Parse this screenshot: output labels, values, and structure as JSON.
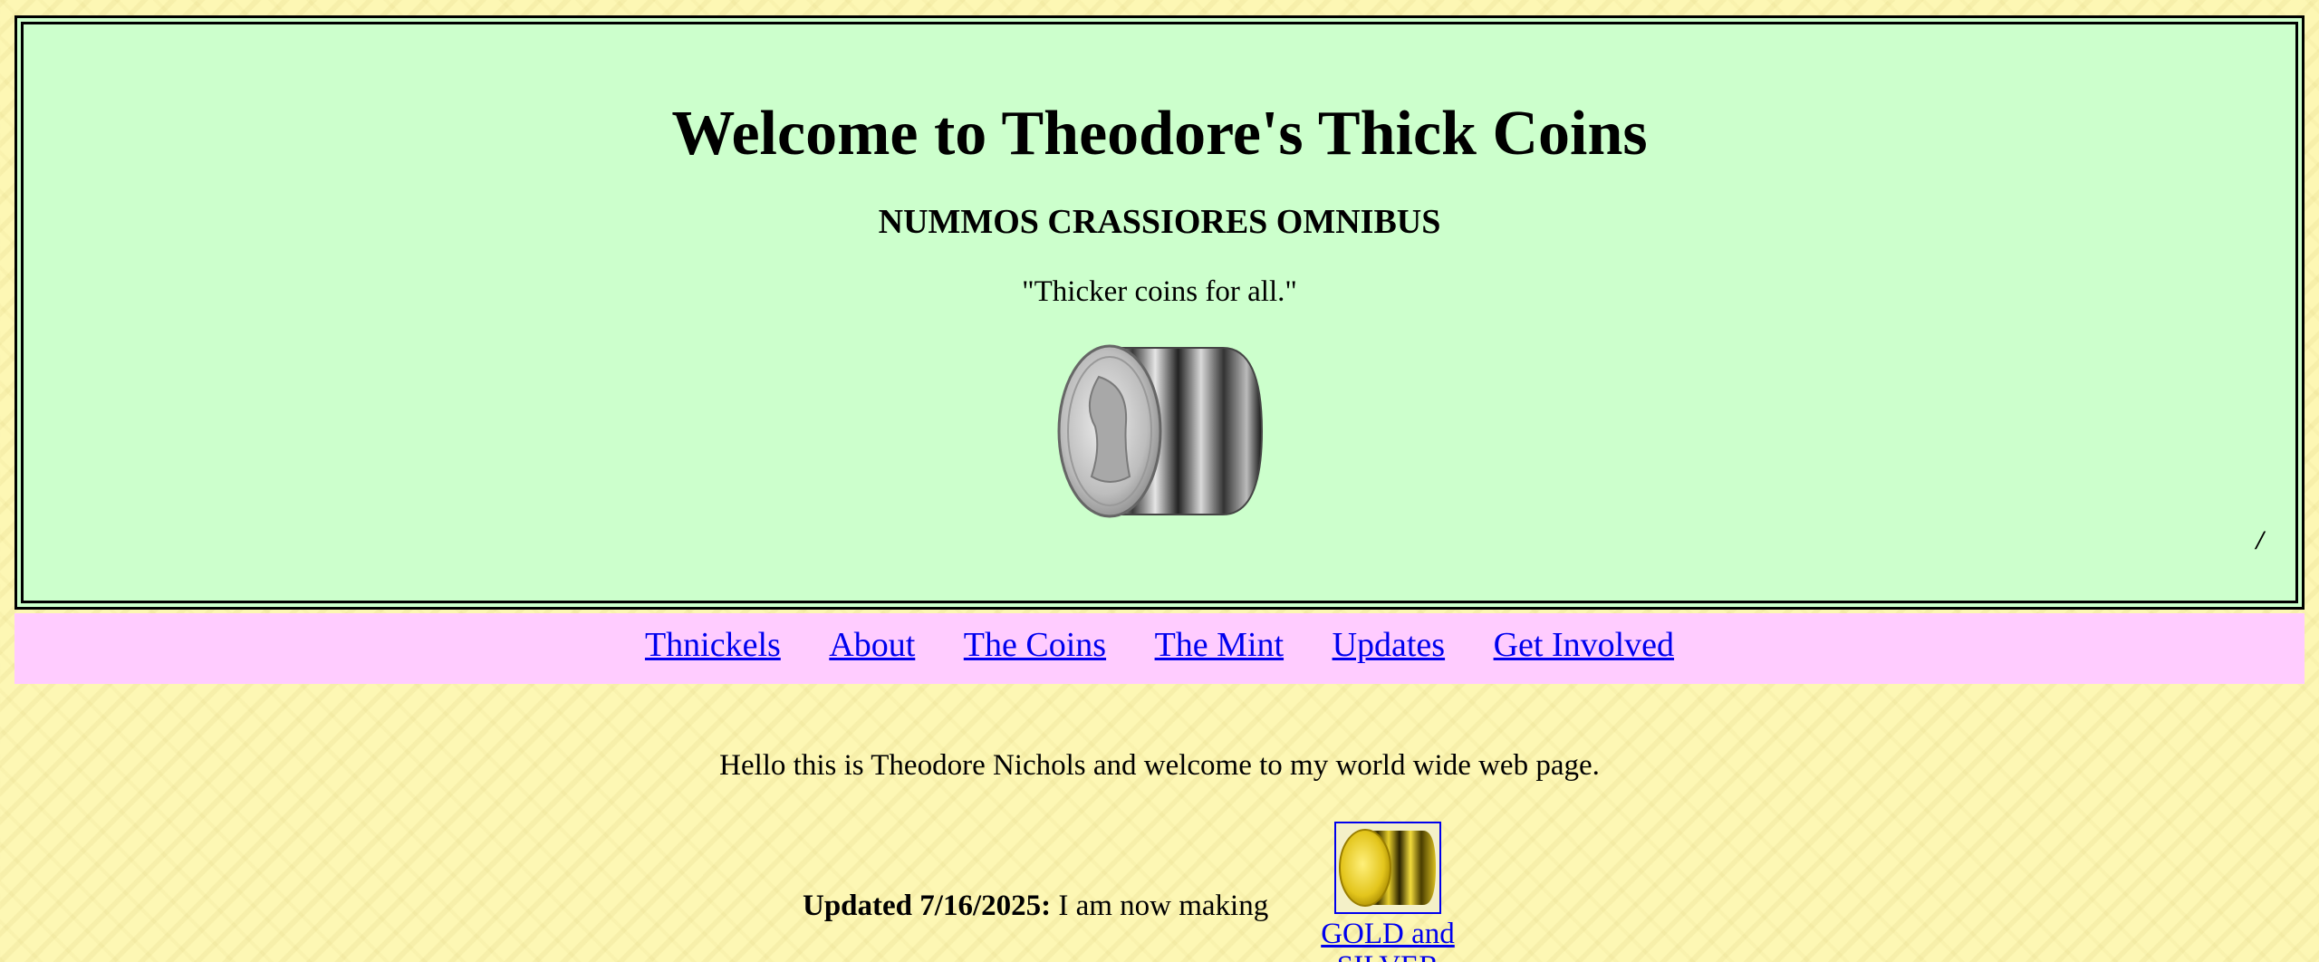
{
  "header": {
    "title": "Welcome to Theodore's Thick Coins",
    "motto": "NUMMOS CRASSIORES OMNIBUS",
    "motto_translation": "\"Thicker coins for all.\"",
    "coin_image": "thick-silver-coin",
    "corner_mark": "/"
  },
  "nav": {
    "items": [
      {
        "label": "Thnickels"
      },
      {
        "label": "About"
      },
      {
        "label": "The Coins"
      },
      {
        "label": "The Mint"
      },
      {
        "label": "Updates"
      },
      {
        "label": "Get Involved"
      }
    ]
  },
  "main": {
    "intro": "Hello this is Theodore Nichols and welcome to my world wide web page.",
    "update": {
      "date_label": "Updated 7/16/2025:",
      "text": " I am now making",
      "link_label": "GOLD and SILVER",
      "link_image": "thick-gold-coin"
    }
  },
  "colors": {
    "page_background": "#fdf7b4",
    "header_background": "#ccffcc",
    "nav_background": "#ffccff",
    "link": "#0000ee"
  }
}
